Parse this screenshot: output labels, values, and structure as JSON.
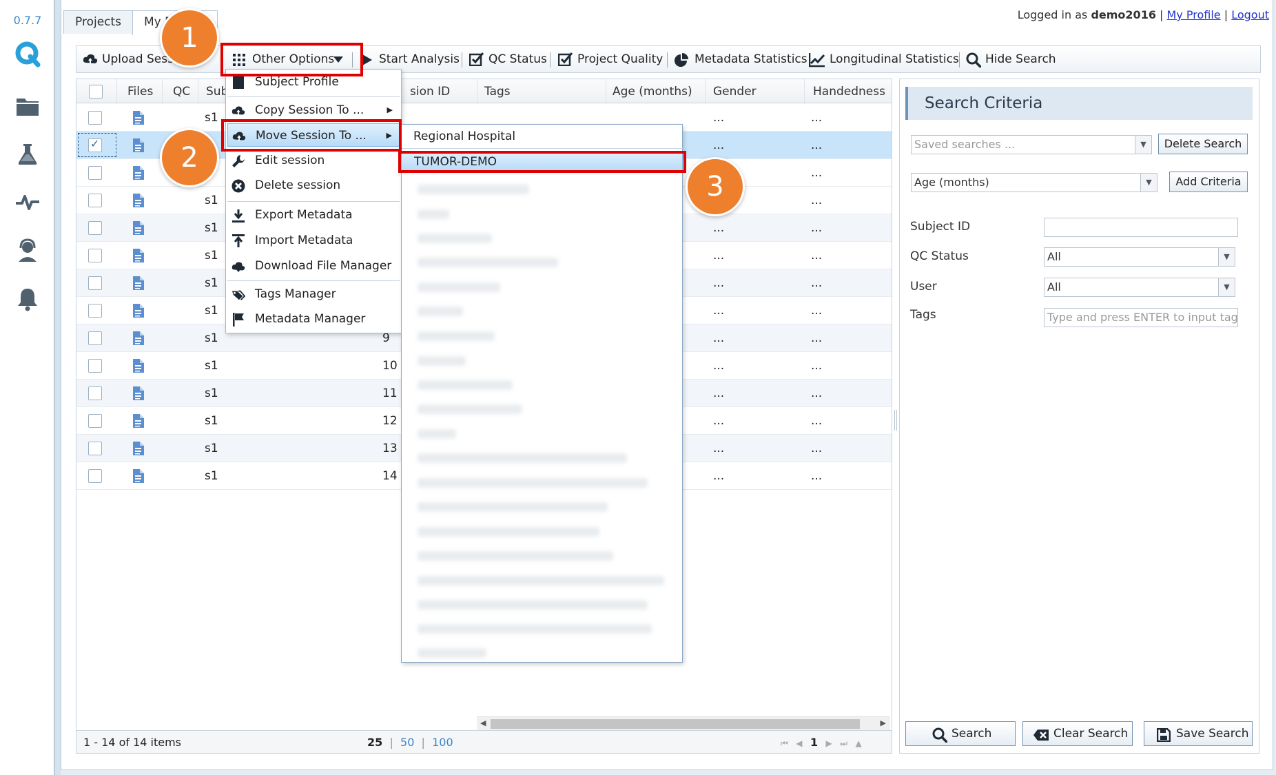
{
  "app": {
    "version": "0.7.7",
    "tabs": [
      "Projects",
      "My D"
    ],
    "user": {
      "prefix": "Logged in as",
      "name": "demo2016",
      "profile": "My Profile",
      "logout": "Logout",
      "sep": "|"
    }
  },
  "toolbar": {
    "upload": "Upload Sess",
    "other_options": "Other Options",
    "start_analysis": "Start Analysis",
    "qc_status": "QC Status",
    "project_quality": "Project Quality",
    "metadata_statistics": "Metadata Statistics",
    "longitudinal_statistics": "Longitudinal Statistics",
    "hide_search": "Hide Search"
  },
  "grid": {
    "columns": [
      "Files",
      "QC",
      "Sub",
      "sion ID",
      "Tags",
      "Age (months)",
      "Gender",
      "Handedness"
    ],
    "rows": [
      {
        "subject": "s1",
        "session": "",
        "gender": "...",
        "hand": "...",
        "checked": false
      },
      {
        "subject": "",
        "session": "",
        "gender": "...",
        "hand": "...",
        "checked": true
      },
      {
        "subject": "",
        "session": "",
        "gender": "...",
        "hand": "...",
        "checked": false
      },
      {
        "subject": "s1",
        "session": "",
        "gender": "...",
        "hand": "...",
        "checked": false
      },
      {
        "subject": "s1",
        "session": "",
        "gender": "...",
        "hand": "...",
        "checked": false
      },
      {
        "subject": "s1",
        "session": "",
        "gender": "...",
        "hand": "...",
        "checked": false
      },
      {
        "subject": "s1",
        "session": "",
        "gender": "...",
        "hand": "...",
        "checked": false
      },
      {
        "subject": "s1",
        "session": "",
        "gender": "...",
        "hand": "...",
        "checked": false
      },
      {
        "subject": "s1",
        "session": "9",
        "gender": "...",
        "hand": "...",
        "checked": false
      },
      {
        "subject": "s1",
        "session": "10",
        "gender": "...",
        "hand": "...",
        "checked": false
      },
      {
        "subject": "s1",
        "session": "11",
        "gender": "...",
        "hand": "...",
        "checked": false
      },
      {
        "subject": "s1",
        "session": "12",
        "gender": "...",
        "hand": "...",
        "checked": false
      },
      {
        "subject": "s1",
        "session": "13",
        "gender": "...",
        "hand": "...",
        "checked": false
      },
      {
        "subject": "s1",
        "session": "14",
        "gender": "...",
        "hand": "...",
        "checked": false
      }
    ],
    "footer": {
      "items": "1 - 14 of 14 items",
      "sizes": [
        "25",
        "50",
        "100"
      ],
      "page": "1"
    }
  },
  "menu": {
    "items": [
      {
        "label": "Subject Profile",
        "icon": "profile-icon",
        "sub": false
      },
      {
        "label": "Copy Session To ...",
        "icon": "cloud-upload-icon",
        "sub": true
      },
      {
        "label": "Move Session To ...",
        "icon": "cloud-upload-icon",
        "sub": true
      },
      {
        "label": "Edit session",
        "icon": "wrench-icon",
        "sub": false
      },
      {
        "label": "Delete session",
        "icon": "delete-circle-icon",
        "sub": false
      },
      {
        "label": "Export Metadata",
        "icon": "download-icon",
        "sub": false
      },
      {
        "label": "Import Metadata",
        "icon": "upload-icon",
        "sub": false
      },
      {
        "label": "Download File Manager",
        "icon": "cloud-download-icon",
        "sub": false
      },
      {
        "label": "Tags Manager",
        "icon": "tags-icon",
        "sub": false
      },
      {
        "label": "Metadata Manager",
        "icon": "flag-icon",
        "sub": false
      }
    ],
    "submenu": [
      "Regional Hospital",
      "TUMOR-DEMO"
    ]
  },
  "search": {
    "title": "Search Criteria",
    "saved_placeholder": "Saved searches ...",
    "delete": "Delete Search",
    "criteria": "Age (months)",
    "add": "Add Criteria",
    "subject_id": "Subject ID",
    "qc_status": "QC Status",
    "qc_value": "All",
    "user": "User",
    "user_value": "All",
    "tags": "Tags",
    "tags_placeholder": "Type and press ENTER to input tag",
    "search_btn": "Search",
    "clear_btn": "Clear Search",
    "save_btn": "Save Search"
  },
  "badges": [
    "1",
    "2",
    "3"
  ],
  "colors": {
    "accent": "#3a86c8",
    "annotation_red": "#e00000",
    "badge_orange": "#ee7f2d",
    "selected_row": "#c8e4fb"
  }
}
